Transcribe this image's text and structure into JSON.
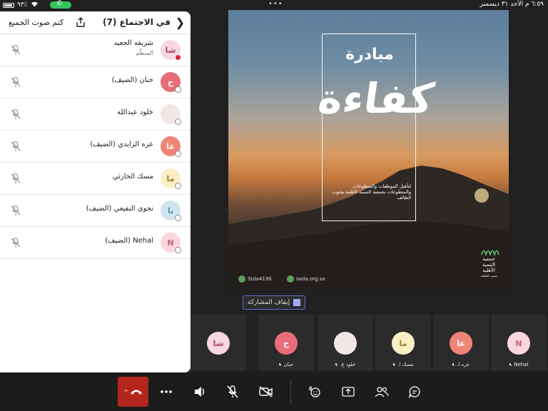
{
  "status_bar": {
    "time": "٦:٥٩ م  الأحد ٣١ ديسمبر",
    "battery": "٩٣٪",
    "dots": "•••"
  },
  "panel": {
    "title": "في الاجتماع (7)",
    "mute_all": "كتم صوت الجميع",
    "participants": [
      {
        "name": "شريفه الجعيد",
        "role": "المنظّم",
        "initials": "شا",
        "avatar_bg": "#f7d8e4",
        "avatar_fg": "#a84a6c",
        "status": "host"
      },
      {
        "name": "حنان (الضيف)",
        "role": "",
        "initials": "ح",
        "avatar_bg": "#e96d78",
        "avatar_fg": "#ffffff",
        "status": "guest"
      },
      {
        "name": "خلود عبدالله",
        "role": "",
        "initials": "",
        "avatar_bg": "#f3e6e6",
        "avatar_fg": "#a66",
        "status": "guest"
      },
      {
        "name": "عزه الزايدي (الضيف)",
        "role": "",
        "initials": "عا",
        "avatar_bg": "#f08477",
        "avatar_fg": "#ffffff",
        "status": "guest"
      },
      {
        "name": "مسك الحارثي",
        "role": "",
        "initials": "ما",
        "avatar_bg": "#fbefc6",
        "avatar_fg": "#9a7a26",
        "status": "guest"
      },
      {
        "name": "نجوى النفيعي (الضيف)",
        "role": "",
        "initials": "نا",
        "avatar_bg": "#cfe4ee",
        "avatar_fg": "#5c8ea8",
        "status": "guest"
      },
      {
        "name": "Nehal (الضيف)",
        "role": "",
        "initials": "N",
        "avatar_bg": "#fbd6dd",
        "avatar_fg": "#c2627a",
        "status": "guest"
      }
    ]
  },
  "shared_content": {
    "heading": "مبادرة",
    "title": "كفاءة",
    "description": "لتأهيل الموظفات والمتطوعات والمتطوعات بجمعية التنمية الأهلية بجنوب الطائف",
    "org_name_line1": "جمعية",
    "org_name_line2": "التنمية",
    "org_name_line3": "الأهلية",
    "org_sub": "بجنوب الطائف",
    "twitter": "Stda4190",
    "website": "soda.org.sa"
  },
  "stop_share_label": "إيقاف المشاركة",
  "gallery": [
    {
      "initials": "شا",
      "label": "",
      "bg": "#f7d8e4",
      "fg": "#a84a6c"
    },
    {
      "initials": "ح",
      "label": "حنان",
      "bg": "#e96d78",
      "fg": "#ffffff"
    },
    {
      "initials": "",
      "label": "خلود ع.",
      "bg": "#f3e6e6",
      "fg": "#a66"
    },
    {
      "initials": "ما",
      "label": "مسك ا.",
      "bg": "#fbefc6",
      "fg": "#9a7a26"
    },
    {
      "initials": "عا",
      "label": "عزه ا.",
      "bg": "#f08477",
      "fg": "#ffffff"
    },
    {
      "initials": "N",
      "label": "Nehal",
      "bg": "#fbd6dd",
      "fg": "#c2627a"
    }
  ],
  "colors": {
    "end_call": "#b3261e",
    "accent": "#5a6fd6"
  }
}
